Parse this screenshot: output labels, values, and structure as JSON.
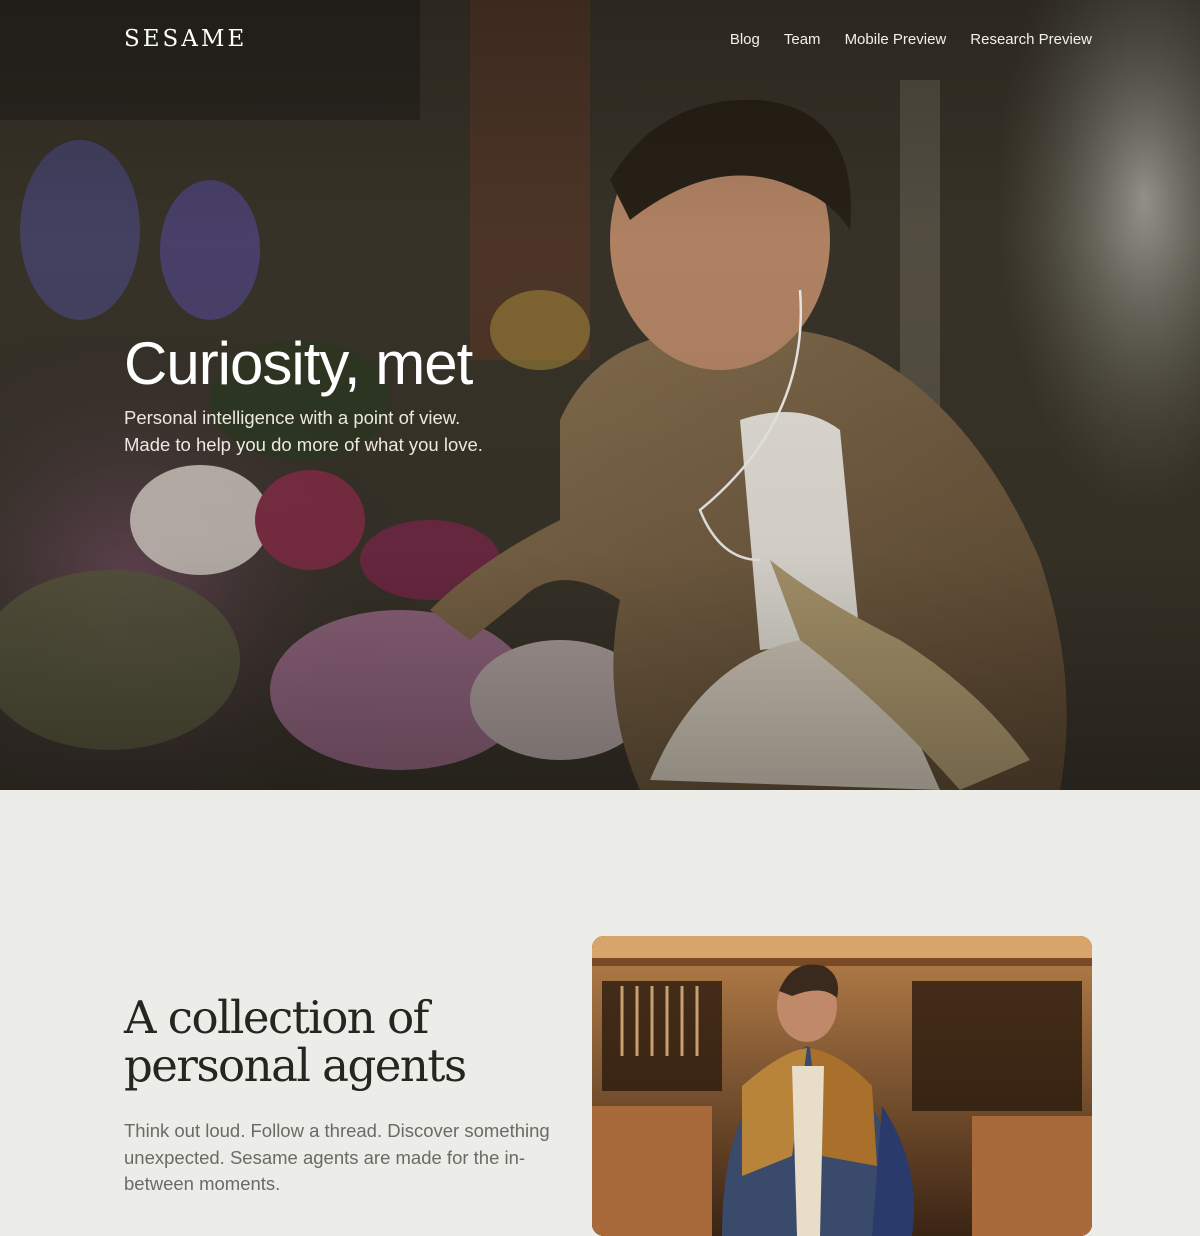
{
  "nav": {
    "logo": "SESAME",
    "links": [
      {
        "label": "Blog"
      },
      {
        "label": "Team"
      },
      {
        "label": "Mobile Preview"
      },
      {
        "label": "Research Preview"
      }
    ]
  },
  "hero": {
    "title": "Curiosity, met",
    "subtitle_line1": "Personal intelligence with a point of view.",
    "subtitle_line2": "Made to help you do more of what you love."
  },
  "agents": {
    "title_line1": "A collection of",
    "title_line2": "personal agents",
    "body": "Think out loud. Follow a thread. Discover something unexpected. Sesame agents are made for the in-between moments."
  },
  "images": {
    "hero": "man-with-earphones-at-flower-market-photo",
    "agents": "woodworker-in-workshop-photo"
  },
  "colors": {
    "page_bg": "#ecece8",
    "heading_dark": "#26251f",
    "body_gray": "#6b6a64"
  }
}
